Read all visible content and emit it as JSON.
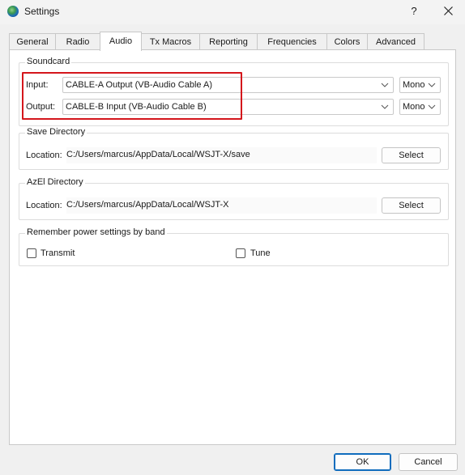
{
  "window": {
    "title": "Settings",
    "help_label": "?"
  },
  "tabs": [
    {
      "label": "General"
    },
    {
      "label": "Radio"
    },
    {
      "label": "Audio"
    },
    {
      "label": "Tx Macros"
    },
    {
      "label": "Reporting"
    },
    {
      "label": "Frequencies"
    },
    {
      "label": "Colors"
    },
    {
      "label": "Advanced"
    }
  ],
  "active_tab": "Audio",
  "soundcard": {
    "title": "Soundcard",
    "input_label": "Input:",
    "input_value": "CABLE-A Output (VB-Audio Cable A)",
    "input_channel": "Mono",
    "output_label": "Output:",
    "output_value": "CABLE-B Input (VB-Audio Cable B)",
    "output_channel": "Mono"
  },
  "save_dir": {
    "title": "Save Directory",
    "location_label": "Location:",
    "path": "C:/Users/marcus/AppData/Local/WSJT-X/save",
    "select_label": "Select"
  },
  "azel_dir": {
    "title": "AzEl Directory",
    "location_label": "Location:",
    "path": "C:/Users/marcus/AppData/Local/WSJT-X",
    "select_label": "Select"
  },
  "power": {
    "title": "Remember power settings by band",
    "transmit_label": "Transmit",
    "transmit_checked": false,
    "tune_label": "Tune",
    "tune_checked": false
  },
  "footer": {
    "ok_label": "OK",
    "cancel_label": "Cancel"
  },
  "colors": {
    "highlight": "#d4161c",
    "default_button_border": "#0f6cbd"
  }
}
